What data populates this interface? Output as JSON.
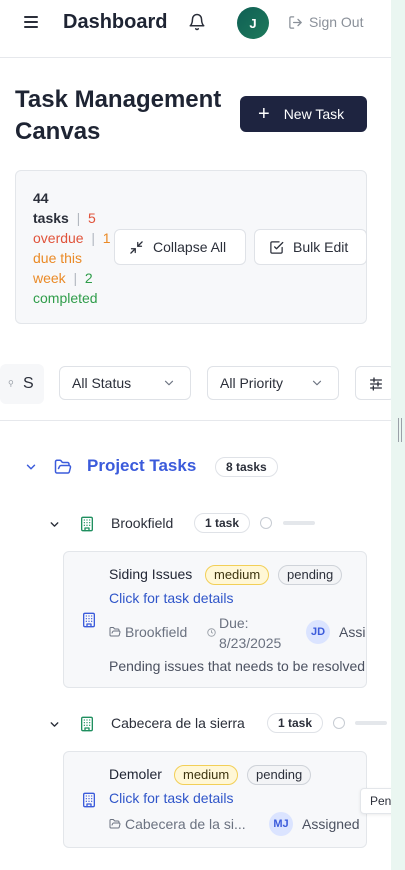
{
  "header": {
    "brand": "Dashboard",
    "avatar_initial": "J",
    "sign_out_label": "Sign Out"
  },
  "page": {
    "title": "Task Management Canvas",
    "new_task_label": "New Task"
  },
  "stats": {
    "total_count": "44",
    "total_label": "tasks",
    "overdue": "5 overdue",
    "due_week": "1 due this week",
    "completed": "2 completed",
    "collapse_label": "Collapse All",
    "bulk_edit_label": "Bulk Edit"
  },
  "filters": {
    "search_value": "S",
    "status_selected": "All Status",
    "priority_selected": "All Priority"
  },
  "groups": [
    {
      "title": "Project Tasks",
      "count_label": "8 tasks",
      "subgroups": [
        {
          "title": "Brookfield",
          "count_label": "1 task",
          "tasks": [
            {
              "title": "Siding Issues",
              "priority": "medium",
              "status": "pending",
              "link": "Click for task details",
              "location": "Brookfield",
              "due_label": "Due:",
              "due_date": "8/23/2025",
              "assignee_initials": "JD",
              "assigned_label": "Assigned",
              "description": "Pending issues that needs to be resolved b..."
            }
          ]
        },
        {
          "title": "Cabecera de la sierra",
          "count_label": "1 task",
          "tasks": [
            {
              "title": "Demoler",
              "priority": "medium",
              "status": "pending",
              "link": "Click for task details",
              "location": "Cabecera de la si...",
              "assignee_initials": "MJ",
              "assigned_label": "Assigned"
            }
          ]
        }
      ]
    }
  ],
  "tooltip": {
    "text": "Pen"
  },
  "colors": {
    "primary_dark": "#1e2440",
    "group_title": "#3b5bdb",
    "link": "#2f55c9",
    "overdue": "#e0533b",
    "due_week": "#ea8a26",
    "completed": "#2f9d4a",
    "building_icon": "#1f8f5f"
  }
}
